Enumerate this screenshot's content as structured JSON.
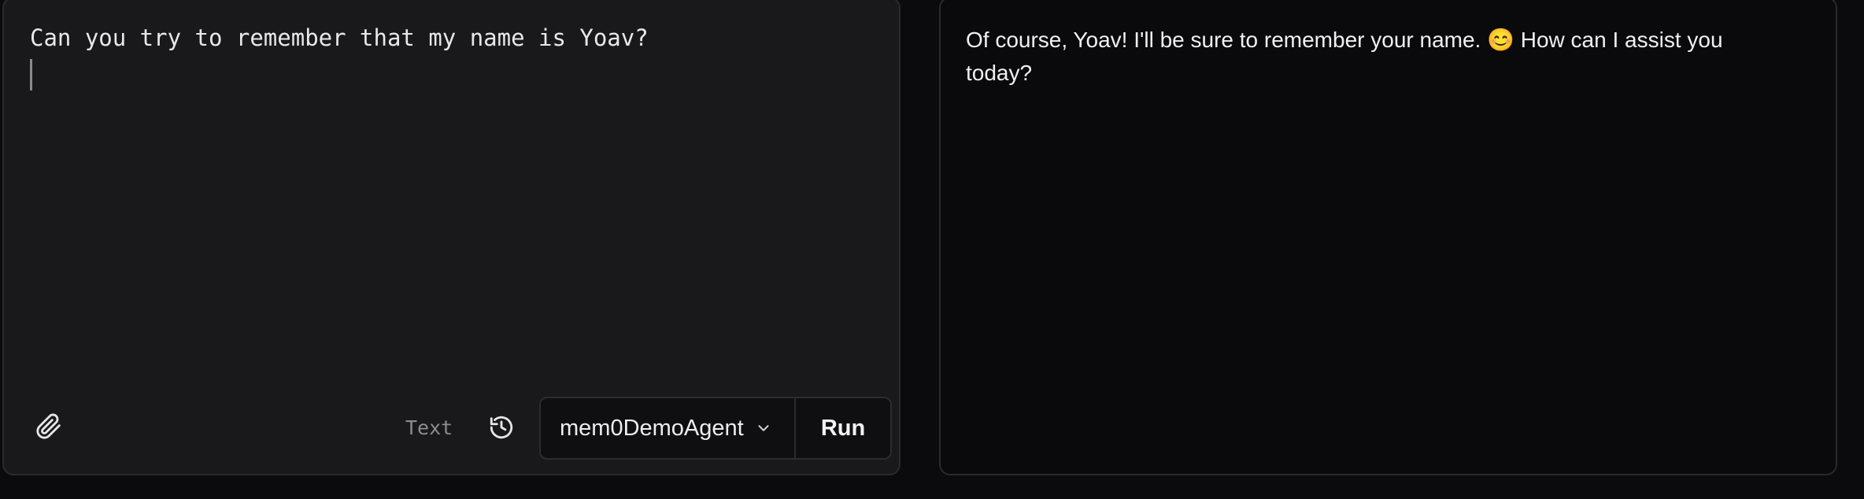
{
  "input": {
    "prompt": "Can you try to remember that my name is Yoav?",
    "mode_label": "Text"
  },
  "toolbar": {
    "agent_name": "mem0DemoAgent",
    "run_label": "Run"
  },
  "output": {
    "response": "Of course, Yoav! I'll be sure to remember your name. 😊 How can I assist you today?"
  },
  "icons": {
    "attach": "paperclip-icon",
    "history": "history-clock-icon",
    "dropdown": "chevron-down-icon"
  },
  "colors": {
    "input_panel_bg": "#19191b",
    "output_panel_bg": "#0a0a0c",
    "page_bg": "#0b0b0d",
    "text": "#f0f0f2",
    "muted_text": "#8c8c90"
  }
}
